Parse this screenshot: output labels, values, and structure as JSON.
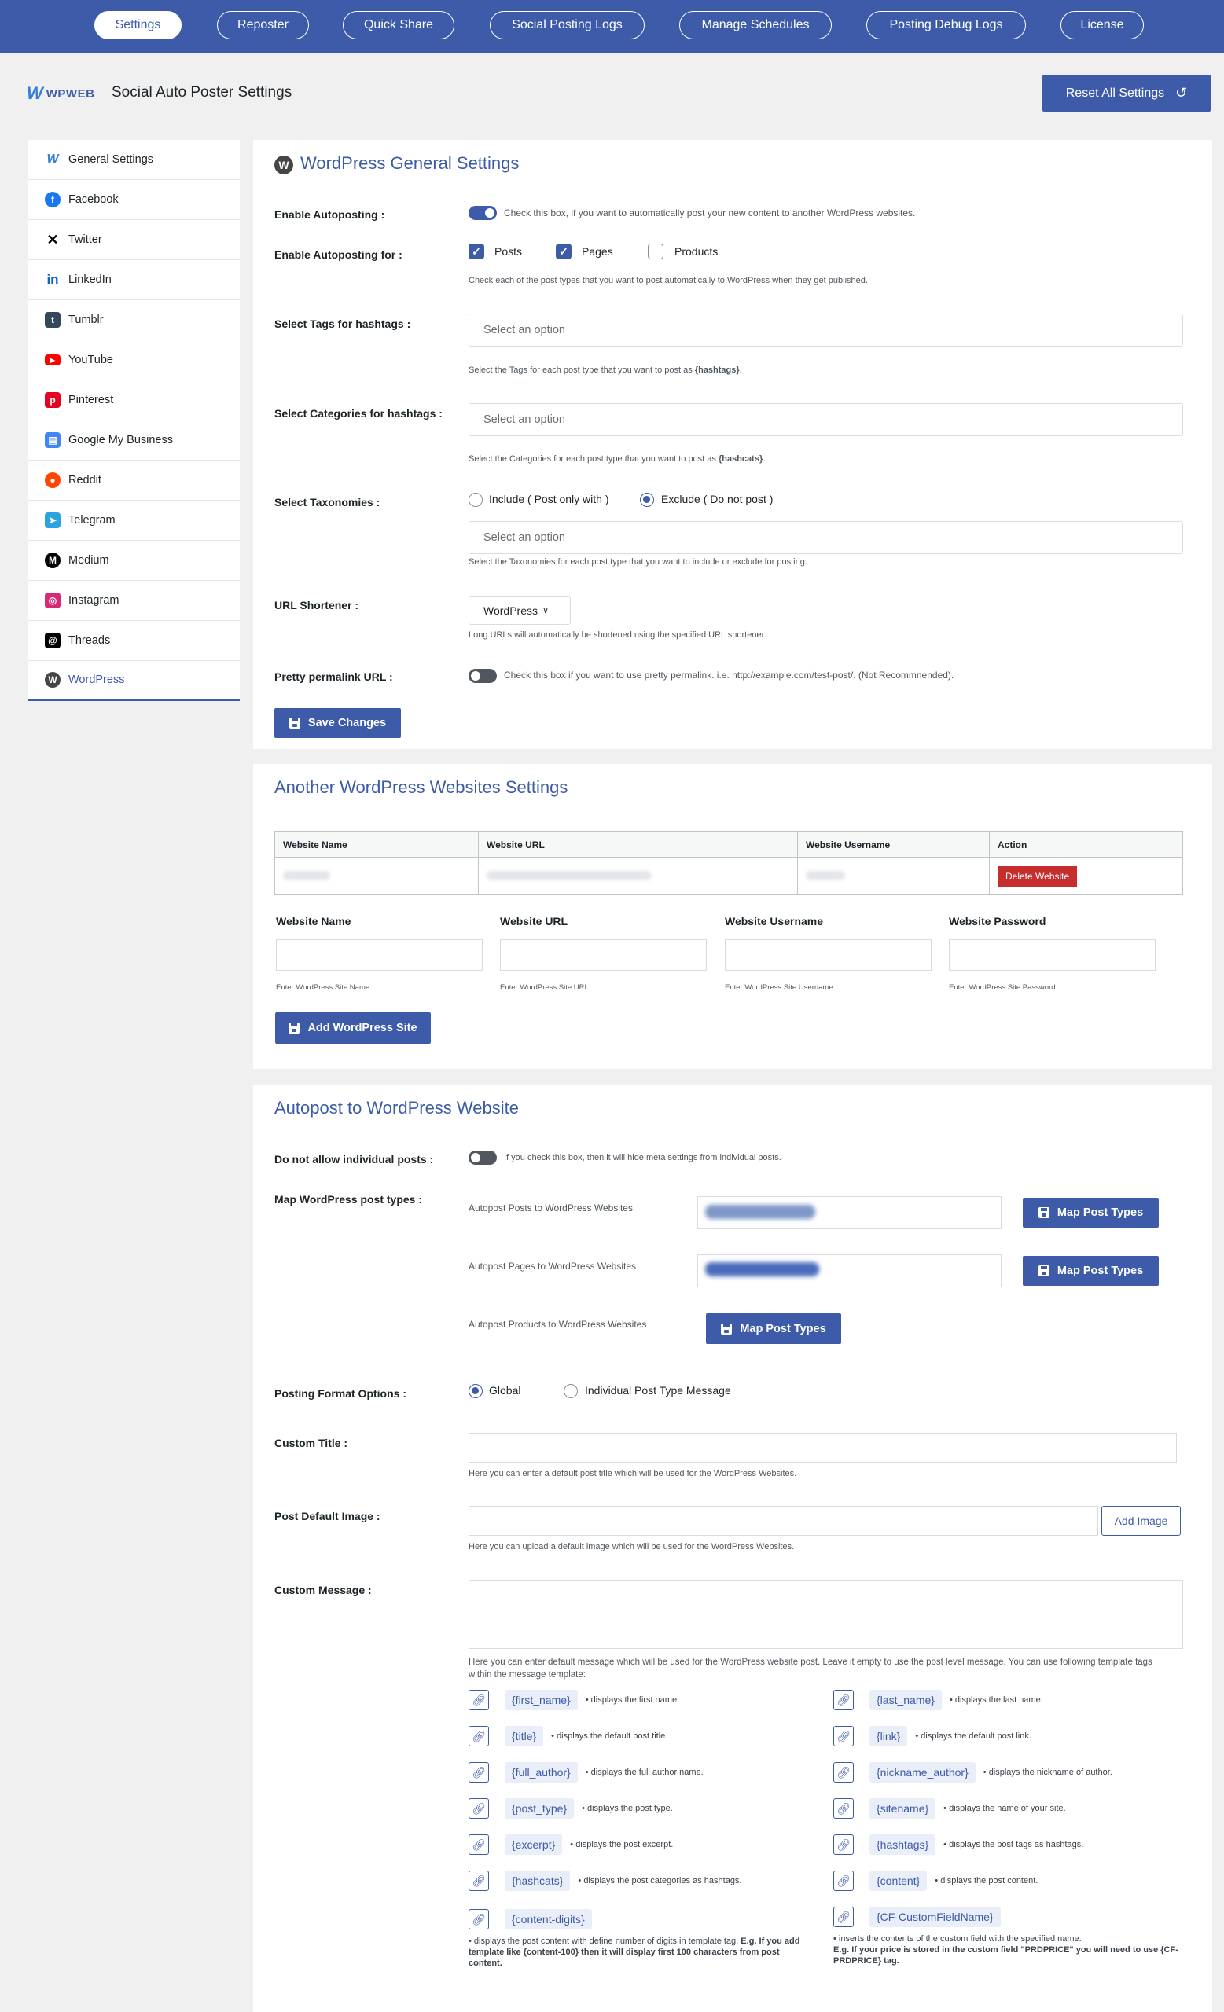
{
  "topnav": {
    "tabs": [
      {
        "label": "Settings",
        "active": true
      },
      {
        "label": "Reposter"
      },
      {
        "label": "Quick Share"
      },
      {
        "label": "Social Posting Logs"
      },
      {
        "label": "Manage Schedules"
      },
      {
        "label": "Posting Debug Logs"
      },
      {
        "label": "License"
      }
    ]
  },
  "header": {
    "logo_w": "W",
    "logo_text": "WPWEB",
    "title": "Social Auto Poster Settings",
    "reset_label": "Reset All Settings"
  },
  "sidebar": {
    "items": [
      {
        "label": "General Settings",
        "icon": "wpweb-icon",
        "color": "#3d7ed6"
      },
      {
        "label": "Facebook",
        "icon": "facebook-icon",
        "color": "#1877f2"
      },
      {
        "label": "Twitter",
        "icon": "x-icon",
        "color": "#000000"
      },
      {
        "label": "LinkedIn",
        "icon": "linkedin-icon",
        "color": "#0a66c2"
      },
      {
        "label": "Tumblr",
        "icon": "tumblr-icon",
        "color": "#36465d"
      },
      {
        "label": "YouTube",
        "icon": "youtube-icon",
        "color": "#ff0000"
      },
      {
        "label": "Pinterest",
        "icon": "pinterest-icon",
        "color": "#e60023"
      },
      {
        "label": "Google My Business",
        "icon": "google-my-business-icon",
        "color": "#4285f4"
      },
      {
        "label": "Reddit",
        "icon": "reddit-icon",
        "color": "#ff4500"
      },
      {
        "label": "Telegram",
        "icon": "telegram-icon",
        "color": "#2aa3df"
      },
      {
        "label": "Medium",
        "icon": "medium-icon",
        "color": "#000000"
      },
      {
        "label": "Instagram",
        "icon": "instagram-icon",
        "color": "#d62976"
      },
      {
        "label": "Threads",
        "icon": "threads-icon",
        "color": "#000000"
      },
      {
        "label": "WordPress",
        "icon": "wordpress-icon",
        "color": "#464646",
        "active": true
      }
    ]
  },
  "general": {
    "title": "WordPress General Settings",
    "enable_label": "Enable Autoposting :",
    "enable_desc": "Check this box, if you want to automatically post your new content to another WordPress websites.",
    "enable_for_label": "Enable Autoposting for :",
    "types": [
      "Posts",
      "Pages",
      "Products"
    ],
    "enable_for_desc": "Check each of the post types that you want to post automatically to WordPress when they get published.",
    "tags_label": "Select Tags for hashtags :",
    "tags_placeholder": "Select an option",
    "tags_desc_pre": "Select the Tags for each post type that you want to post as ",
    "tags_desc_tag": "{hashtags}",
    "tags_desc_post": ".",
    "cats_label": "Select Categories for hashtags :",
    "cats_placeholder": "Select an option",
    "cats_desc_pre": "Select the Categories for each post type that you want to post as ",
    "cats_desc_tag": "{hashcats}",
    "cats_desc_post": ".",
    "tax_label": "Select Taxonomies :",
    "tax_include": "Include ( Post only with )",
    "tax_exclude": "Exclude ( Do not post )",
    "tax_placeholder": "Select an option",
    "tax_desc": "Select the Taxonomies for each post type that you want to include or exclude for posting.",
    "shortener_label": "URL Shortener :",
    "shortener_value": "WordPress",
    "shortener_desc": "Long URLs will automatically be shortened using the specified URL shortener.",
    "pretty_label": "Pretty permalink URL :",
    "pretty_desc": "Check this box if you want to use pretty permalink. i.e. http://example.com/test-post/. (Not Recommnended).",
    "save_label": "Save Changes"
  },
  "sites": {
    "title": "Another WordPress Websites Settings",
    "columns": [
      "Website Name",
      "Website URL",
      "Website Username",
      "Action"
    ],
    "delete_label": "Delete Website",
    "fields": [
      {
        "label": "Website Name",
        "desc": "Enter WordPress Site Name."
      },
      {
        "label": "Website URL",
        "desc": "Enter WordPress Site URL."
      },
      {
        "label": "Website Username",
        "desc": "Enter WordPress Site Username."
      },
      {
        "label": "Website Password",
        "desc": "Enter WordPress Site Password."
      }
    ],
    "add_label": "Add WordPress Site"
  },
  "autopost": {
    "title": "Autopost to WordPress Website",
    "no_individual_label": "Do not allow individual posts :",
    "no_individual_desc": "If you check this box, then it will hide meta settings from individual posts.",
    "map_label": "Map WordPress post types :",
    "map_rows": [
      {
        "label": "Autopost Posts to WordPress Websites"
      },
      {
        "label": "Autopost Pages to WordPress Websites"
      },
      {
        "label": "Autopost Products to WordPress Websites"
      }
    ],
    "map_btn": "Map Post Types",
    "format_label": "Posting Format Options :",
    "format_global": "Global",
    "format_individual": "Individual Post Type Message",
    "custom_title_label": "Custom Title :",
    "custom_title_desc": "Here you can enter a default post title which will be used for the WordPress Websites.",
    "default_image_label": "Post Default Image :",
    "add_image": "Add Image",
    "default_image_desc": "Here you can upload a default image which will be used for the WordPress Websites.",
    "custom_message_label": "Custom Message :",
    "custom_message_desc": "Here you can enter default message which will be used for the WordPress website post. Leave it empty to use the post level message. You can use following template tags within the message template:",
    "tags_left": [
      {
        "tag": "{first_name}",
        "desc": "displays the first name."
      },
      {
        "tag": "{title}",
        "desc": "displays the default post title."
      },
      {
        "tag": "{full_author}",
        "desc": "displays the full author name."
      },
      {
        "tag": "{post_type}",
        "desc": "displays the post type."
      },
      {
        "tag": "{excerpt}",
        "desc": "displays the post excerpt."
      },
      {
        "tag": "{hashcats}",
        "desc": "displays the post categories as hashtags."
      },
      {
        "tag": "{content-digits}",
        "desc": ""
      }
    ],
    "tags_right": [
      {
        "tag": "{last_name}",
        "desc": "displays the last name."
      },
      {
        "tag": "{link}",
        "desc": "displays the default post link."
      },
      {
        "tag": "{nickname_author}",
        "desc": "displays the nickname of author."
      },
      {
        "tag": "{sitename}",
        "desc": "displays the name of your site."
      },
      {
        "tag": "{hashtags}",
        "desc": "displays the post tags as hashtags."
      },
      {
        "tag": "{content}",
        "desc": "displays the post content."
      },
      {
        "tag": "{CF-CustomFieldName}",
        "desc": ""
      }
    ],
    "content_digits_desc_pre": "displays the post content with define number of digits in template tag. ",
    "content_digits_desc_bold": "E.g. If you add template like {content-100} then it will display first 100 characters from post content.",
    "cf_desc_pre": "inserts the contents of the custom field with the specified name.",
    "cf_desc_bold": "E.g. If your price is stored in the custom field \"PRDPRICE\" you will need to use {CF-PRDPRICE} tag."
  }
}
